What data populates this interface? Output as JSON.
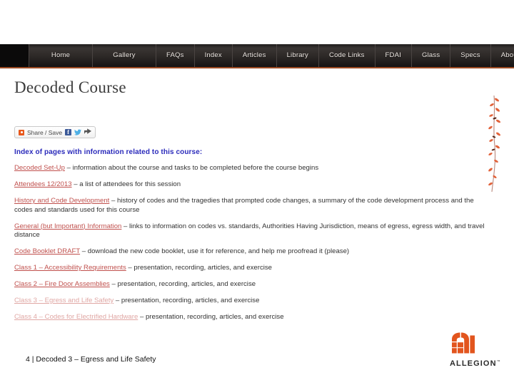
{
  "slide": {
    "footer_text": "4 | Decoded 3 – Egress and Life Safety",
    "logo_wordmark": "ALLEGION",
    "logo_tm": "™"
  },
  "webpage": {
    "nav": {
      "items": [
        {
          "label": "Home"
        },
        {
          "label": "Gallery"
        },
        {
          "label": "FAQs"
        },
        {
          "label": "Index"
        },
        {
          "label": "Articles"
        },
        {
          "label": "Library"
        },
        {
          "label": "Code Links"
        },
        {
          "label": "FDAI"
        },
        {
          "label": "Glass"
        },
        {
          "label": "Specs"
        },
        {
          "label": "About Me"
        }
      ]
    },
    "title": "Decoded Course",
    "share": {
      "label": "Share / Save",
      "facebook_glyph": "f",
      "twitter_glyph": "▼",
      "more_glyph": "↪"
    },
    "intro": "Index of pages with information related to this course:",
    "items": [
      {
        "link": "Decoded Set-Up",
        "desc": " – information about the course and tasks to be completed before the course begins",
        "faded": false
      },
      {
        "link": "Attendees 12/2013",
        "desc": " – a list of attendees for this session",
        "faded": false
      },
      {
        "link": "History and Code Development",
        "desc": " – history of codes and the tragedies that prompted code changes, a summary of the code development process and the codes and standards used for this course",
        "faded": false
      },
      {
        "link": "General (but Important) Information",
        "desc": " – links to information on codes vs. standards, Authorities Having Jurisdiction, means of egress, egress width, and travel distance",
        "faded": false
      },
      {
        "link": "Code Booklet DRAFT",
        "desc": " – download the new code booklet, use it for reference, and help me proofread it (please)",
        "faded": false
      },
      {
        "link": "Class 1 – Accessibility Requirements",
        "desc": " – presentation, recording, articles, and exercise",
        "faded": false
      },
      {
        "link": "Class 2 – Fire Door Assemblies",
        "desc": " – presentation, recording, articles, and exercise",
        "faded": false
      },
      {
        "link": "Class 3 – Egress and Life Safety",
        "desc": " – presentation, recording, articles, and exercise",
        "faded": true
      },
      {
        "link": "Class 4 – Codes for Electrified Hardware",
        "desc": " – presentation, recording, articles, and exercise",
        "faded": true
      }
    ]
  },
  "colors": {
    "link": "#c0504d",
    "heading": "#2b2bbb",
    "nav_accent": "#9c4a22",
    "brand_orange": "#e8581c"
  }
}
